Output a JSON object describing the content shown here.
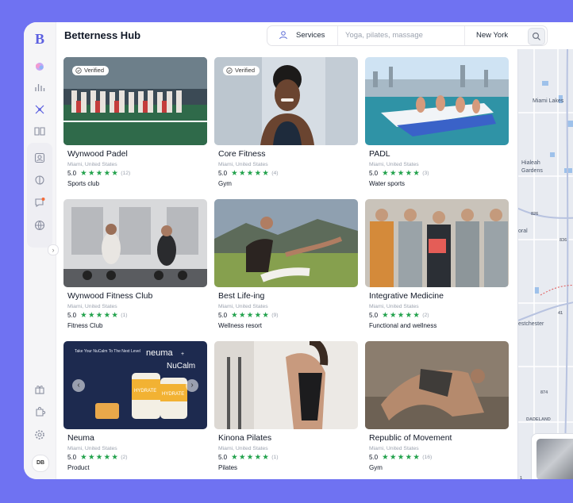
{
  "app": {
    "title": "Betterness Hub",
    "logo": "B"
  },
  "search": {
    "category": "Services",
    "placeholder": "Yoga, pilates, massage",
    "location": "New York"
  },
  "sidebar": {
    "top_icons": [
      "sparkle-icon",
      "bar-chart-icon",
      "network-icon",
      "book-icon"
    ],
    "group_icons": [
      "profile-card-icon",
      "brain-icon",
      "chat-notification-icon",
      "globe-icon"
    ],
    "bottom_icons": [
      "gift-icon",
      "puzzle-icon",
      "gear-icon"
    ],
    "avatar": "DB",
    "collapse": "›"
  },
  "listings": [
    {
      "name": "Wynwood Padel",
      "location": "Miami, United States",
      "rating": "5.0",
      "stars": "★★★★★",
      "reviews": "(12)",
      "category": "Sports club",
      "verified": "Verified"
    },
    {
      "name": "Core Fitness",
      "location": "Miami, United States",
      "rating": "5.0",
      "stars": "★★★★★",
      "reviews": "(4)",
      "category": "Gym",
      "verified": "Verified"
    },
    {
      "name": "PADL",
      "location": "Miami, United States",
      "rating": "5.0",
      "stars": "★★★★★",
      "reviews": "(3)",
      "category": "Water sports"
    },
    {
      "name": "Wynwood Fitness Club",
      "location": "Miami, United States",
      "rating": "5.0",
      "stars": "★★★★★",
      "reviews": "(1)",
      "category": "Fitness Club"
    },
    {
      "name": "Best Life-ing",
      "location": "Miami, United States",
      "rating": "5.0",
      "stars": "★★★★★",
      "reviews": "(9)",
      "category": "Wellness resort"
    },
    {
      "name": "Integrative Medicine",
      "location": "Miami, United States",
      "rating": "5.0",
      "stars": "★★★★★",
      "reviews": "(2)",
      "category": "Functional and wellness"
    },
    {
      "name": "Neuma",
      "location": "Miami, United States",
      "rating": "5.0",
      "stars": "★★★★★",
      "reviews": "(2)",
      "category": "Product"
    },
    {
      "name": "Kinona Pilates",
      "location": "Miami, United States",
      "rating": "5.0",
      "stars": "★★★★★",
      "reviews": "(1)",
      "category": "Pilates"
    },
    {
      "name": "Republic of Movement",
      "location": "Miami, United States",
      "rating": "5.0",
      "stars": "★★★★★",
      "reviews": "(16)",
      "category": "Gym"
    }
  ],
  "neuma_ad": {
    "text1": "Take Your NuCalm To The Next Level",
    "brand1": "neuma",
    "plus": "+",
    "brand2": "NuCalm",
    "jar": "HYDRATE",
    "prev": "‹",
    "next": "›"
  },
  "map": {
    "labels": [
      "Miami Lakes",
      "Hialeah",
      "Gardens",
      "oral",
      "estchester",
      "DADELAND"
    ],
    "road_shields": [
      "826",
      "836",
      "41",
      "874",
      "1"
    ]
  }
}
